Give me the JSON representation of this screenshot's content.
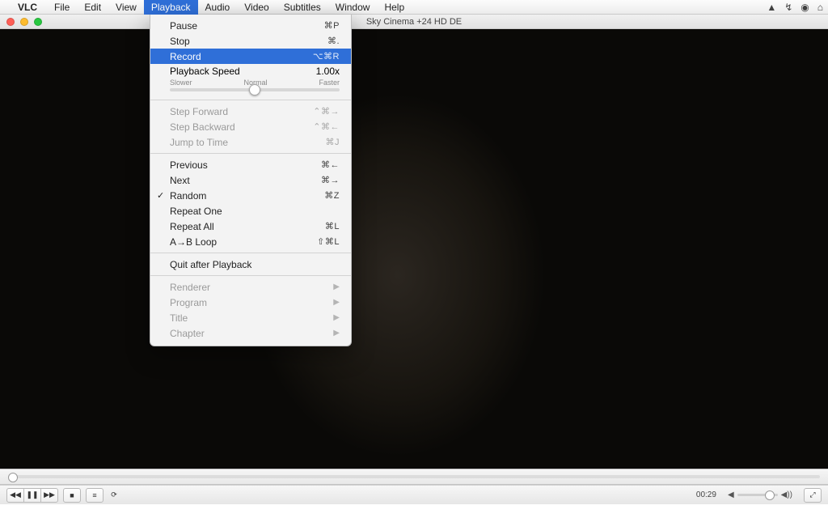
{
  "menubar": {
    "app": "VLC",
    "items": [
      "File",
      "Edit",
      "View",
      "Playback",
      "Audio",
      "Video",
      "Subtitles",
      "Window",
      "Help"
    ],
    "open_index": 3
  },
  "window": {
    "title": "Sky Cinema +24 HD DE"
  },
  "playback_menu": {
    "pause": {
      "label": "Pause",
      "shortcut": "⌘P"
    },
    "stop": {
      "label": "Stop",
      "shortcut": "⌘."
    },
    "record": {
      "label": "Record",
      "shortcut": "⌥⌘R"
    },
    "speed": {
      "label": "Playback Speed",
      "value": "1.00x",
      "slower": "Slower",
      "normal": "Normal",
      "faster": "Faster"
    },
    "step_forward": {
      "label": "Step Forward",
      "shortcut": "⌃⌘→"
    },
    "step_backward": {
      "label": "Step Backward",
      "shortcut": "⌃⌘←"
    },
    "jump_to_time": {
      "label": "Jump to Time",
      "shortcut": "⌘J"
    },
    "previous": {
      "label": "Previous",
      "shortcut": "⌘←"
    },
    "next": {
      "label": "Next",
      "shortcut": "⌘→"
    },
    "random": {
      "label": "Random",
      "shortcut": "⌘Z",
      "checked": true
    },
    "repeat_one": {
      "label": "Repeat One"
    },
    "repeat_all": {
      "label": "Repeat All",
      "shortcut": "⌘L"
    },
    "ab_loop": {
      "label": "A→B Loop",
      "shortcut": "⇧⌘L"
    },
    "quit_after": {
      "label": "Quit after Playback"
    },
    "renderer": {
      "label": "Renderer"
    },
    "program": {
      "label": "Program"
    },
    "title": {
      "label": "Title"
    },
    "chapter": {
      "label": "Chapter"
    }
  },
  "transport": {
    "elapsed": "00:29"
  }
}
